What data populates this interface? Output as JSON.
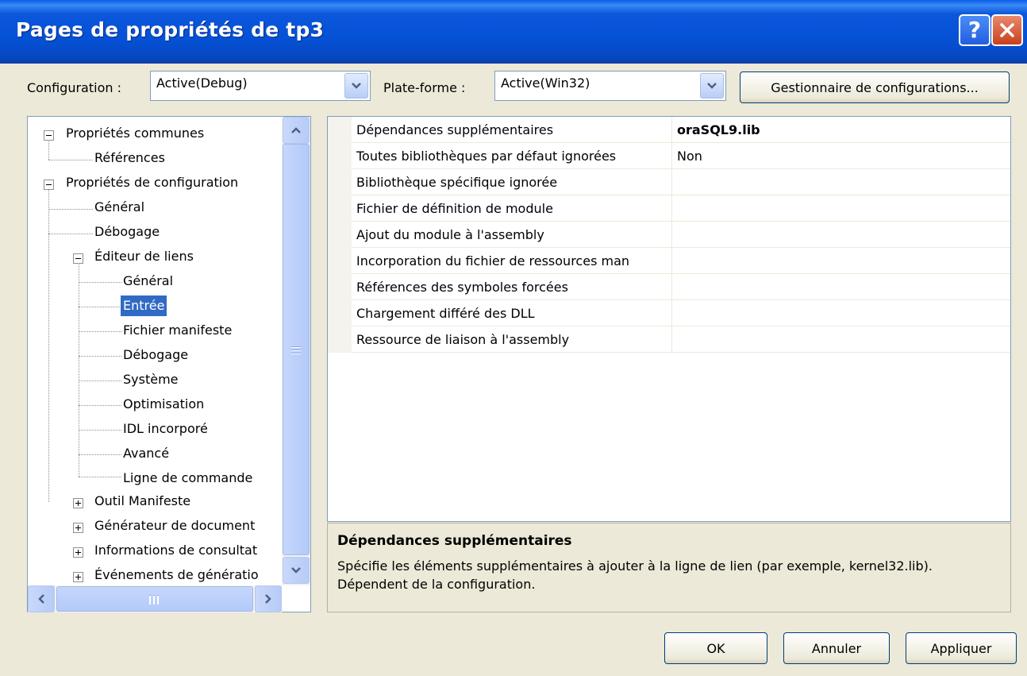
{
  "window": {
    "title": "Pages de propriétés de tp3"
  },
  "titlebar": {
    "help_glyph": "?",
    "help_icon": "help-icon",
    "close_icon": "close-icon"
  },
  "toolbar": {
    "config_label": "Configuration :",
    "config_value": "Active(Debug)",
    "platform_label": "Plate-forme :",
    "platform_value": "Active(Win32)",
    "manager_button": "Gestionnaire de configurations..."
  },
  "tree": {
    "nodes": [
      {
        "label": "Propriétés communes",
        "toggle": "expanded"
      },
      {
        "label": "Références"
      },
      {
        "label": "Propriétés de configuration",
        "toggle": "expanded"
      },
      {
        "label": "Général"
      },
      {
        "label": "Débogage"
      },
      {
        "label": "Éditeur de liens",
        "toggle": "expanded"
      },
      {
        "label": "Général"
      },
      {
        "label": "Entrée",
        "selected": true
      },
      {
        "label": "Fichier manifeste"
      },
      {
        "label": "Débogage"
      },
      {
        "label": "Système"
      },
      {
        "label": "Optimisation"
      },
      {
        "label": "IDL incorporé"
      },
      {
        "label": "Avancé"
      },
      {
        "label": "Ligne de commande"
      },
      {
        "label": "Outil Manifeste",
        "toggle": "collapsed"
      },
      {
        "label": "Générateur de document",
        "toggle": "collapsed"
      },
      {
        "label": "Informations de consultat",
        "toggle": "collapsed"
      },
      {
        "label": "Événements de génératio",
        "toggle": "collapsed"
      }
    ]
  },
  "grid": {
    "rows": [
      {
        "name": "Dépendances supplémentaires",
        "value": "oraSQL9.lib",
        "bold": true
      },
      {
        "name": "Toutes bibliothèques par défaut ignorées",
        "value": "Non"
      },
      {
        "name": "Bibliothèque spécifique ignorée",
        "value": ""
      },
      {
        "name": "Fichier de définition de module",
        "value": ""
      },
      {
        "name": "Ajout du module à l'assembly",
        "value": ""
      },
      {
        "name": "Incorporation du fichier de ressources man",
        "value": ""
      },
      {
        "name": "Références des symboles forcées",
        "value": ""
      },
      {
        "name": "Chargement différé des DLL",
        "value": ""
      },
      {
        "name": "Ressource de liaison à l'assembly",
        "value": ""
      }
    ]
  },
  "description": {
    "title": "Dépendances supplémentaires",
    "text": "Spécifie les éléments supplémentaires à ajouter à la ligne de lien (par exemple, kernel32.lib). Dépendent de la configuration."
  },
  "buttons": {
    "ok": "OK",
    "cancel": "Annuler",
    "apply": "Appliquer"
  },
  "colors": {
    "titlebar": "#0552d6",
    "selection": "#316ac5",
    "dialog_bg": "#ece9d8",
    "close_red": "#c8401e"
  }
}
